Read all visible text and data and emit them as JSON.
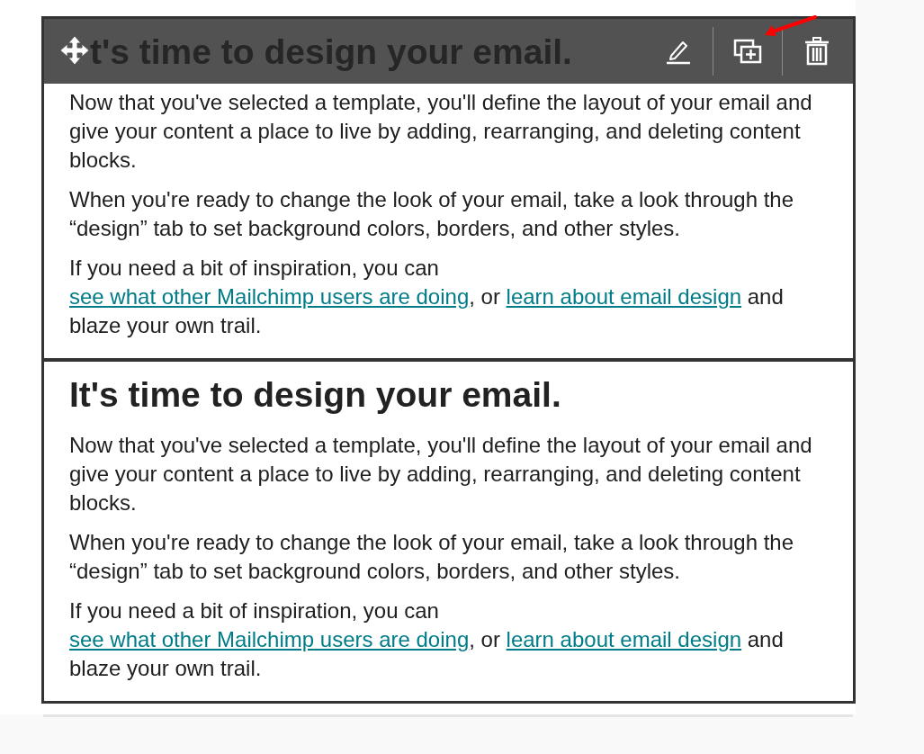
{
  "blocks": [
    {
      "selected": true,
      "heading": "t's time to design your email.",
      "paragraphs": [
        [
          {
            "kind": "text",
            "text": "Now that you've selected a template, you'll define the layout of your email and give your content a place to live by adding, rearranging, and deleting content blocks."
          }
        ],
        [
          {
            "kind": "text",
            "text": "When you're ready to change the look of your email, take a look through the “design” tab to set background colors, borders, and other styles."
          }
        ],
        [
          {
            "kind": "text",
            "text": "If you need a bit of inspiration, you can "
          },
          {
            "kind": "link",
            "text": "see what other Mailchimp users are doing"
          },
          {
            "kind": "text",
            "text": ", or "
          },
          {
            "kind": "link",
            "text": "learn about email design"
          },
          {
            "kind": "text",
            "text": " and blaze your own trail."
          }
        ]
      ]
    },
    {
      "selected": false,
      "heading": "It's time to design your email.",
      "paragraphs": [
        [
          {
            "kind": "text",
            "text": "Now that you've selected a template, you'll define the layout of your email and give your content a place to live by adding, rearranging, and deleting content blocks."
          }
        ],
        [
          {
            "kind": "text",
            "text": "When you're ready to change the look of your email, take a look through the “design” tab to set background colors, borders, and other styles."
          }
        ],
        [
          {
            "kind": "text",
            "text": "If you need a bit of inspiration, you can "
          },
          {
            "kind": "link",
            "text": "see what other Mailchimp users are doing"
          },
          {
            "kind": "text",
            "text": ", or "
          },
          {
            "kind": "link",
            "text": "learn about email design"
          },
          {
            "kind": "text",
            "text": " and blaze your own trail."
          }
        ]
      ]
    }
  ],
  "toolbar": {
    "buttons": [
      {
        "kind": "edit"
      },
      {
        "kind": "duplicate"
      },
      {
        "kind": "delete"
      }
    ]
  }
}
